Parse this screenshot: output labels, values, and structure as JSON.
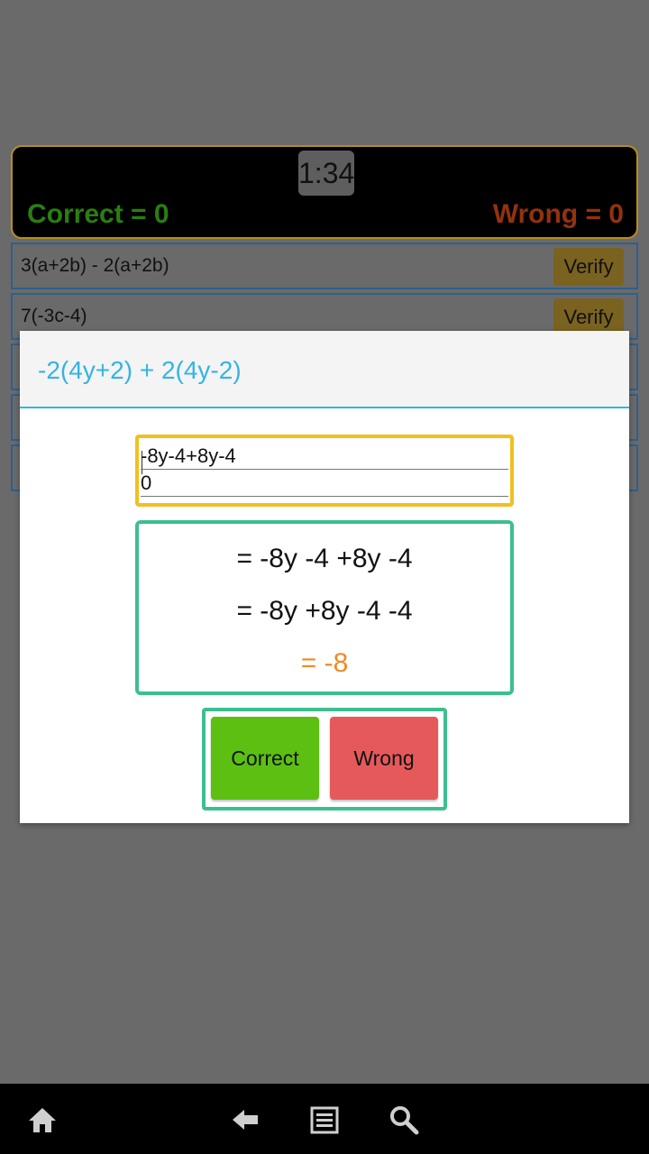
{
  "score": {
    "timer": "1:34",
    "correct_label": "Correct = 0",
    "wrong_label": "Wrong = 0"
  },
  "questions": [
    {
      "text": "3(a+2b) - 2(a+2b)",
      "button": "Verify"
    },
    {
      "text": "7(-3c-4)",
      "button": "Verify"
    }
  ],
  "dialog": {
    "title": "-2(4y+2) + 2(4y-2)",
    "answer_lines": [
      "-8y-4+8y-4",
      "0"
    ],
    "solution_lines": [
      "= -8y -4 +8y -4",
      "= -8y +8y -4 -4",
      "= -8"
    ],
    "correct_button": "Correct",
    "wrong_button": "Wrong"
  },
  "colors": {
    "title_accent": "#33b5e5",
    "answer_border": "#f0c020",
    "solution_border": "#3cbf90",
    "final_answer": "#f08a24",
    "correct_button": "#5cbf12",
    "wrong_button": "#e5595a"
  },
  "nav": {
    "icons": [
      "home-icon",
      "back-icon",
      "list-icon",
      "search-icon"
    ]
  }
}
